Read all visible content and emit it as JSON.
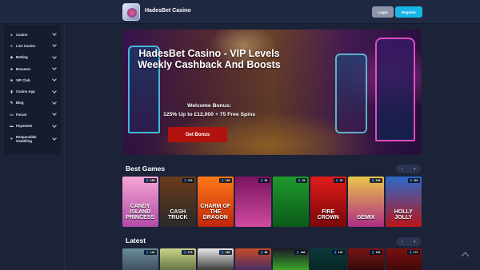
{
  "header": {
    "brand": "HadesBet Casino",
    "login_label": "Login",
    "register_label": "Register"
  },
  "sidebar": {
    "items": [
      {
        "label": "Casino",
        "icon": "♠"
      },
      {
        "label": "Live Casino",
        "icon": "●"
      },
      {
        "label": "Betting",
        "icon": "◆"
      },
      {
        "label": "Bonuses",
        "icon": "■"
      },
      {
        "label": "VIP Club",
        "icon": "★"
      },
      {
        "label": "Casino App",
        "icon": "▮"
      },
      {
        "label": "Blog",
        "icon": "✎"
      },
      {
        "label": "Forum",
        "icon": "▭"
      },
      {
        "label": "Payments",
        "icon": "▬"
      },
      {
        "label": "Responsible Gambling",
        "icon": "♥"
      }
    ]
  },
  "hero": {
    "title": "HadesBet Casino - VIP Levels Weekly Cashback And Boosts",
    "welcome": "Welcome Bonus:",
    "offer": "125% Up to £12,000 + 75 Free Spins",
    "cta": "Get Bonus"
  },
  "best_games": {
    "title": "Best Games",
    "prev": "‹",
    "next": "›",
    "items": [
      {
        "name": "CANDY ISLAND PRINCESS",
        "badge": "👤 155",
        "color_top": "#f6a6d4",
        "color_bot": "#b14aa8"
      },
      {
        "name": "CASH TRUCK",
        "badge": "👤 115",
        "color_top": "#6b3b1c",
        "color_bot": "#2a2a2a"
      },
      {
        "name": "CHARM OF THE DRAGON",
        "badge": "👤 126",
        "color_top": "#ff7a18",
        "color_bot": "#c0260b"
      },
      {
        "name": "",
        "badge": "👤 81",
        "color_top": "#7b1460",
        "color_bot": "#d04aa0"
      },
      {
        "name": "",
        "badge": "👤 25",
        "color_top": "#1e9a2c",
        "color_bot": "#0c5a18"
      },
      {
        "name": "FIRE CROWN",
        "badge": "👤 39",
        "color_top": "#e11b1b",
        "color_bot": "#7a0707"
      },
      {
        "name": "GEMIX",
        "badge": "👤 136",
        "color_top": "#e9c64a",
        "color_bot": "#b02b86"
      },
      {
        "name": "HOLLY JOLLY",
        "badge": "👤 116",
        "color_top": "#2b6ac9",
        "color_bot": "#b8161c"
      }
    ]
  },
  "latest": {
    "title": "Latest",
    "prev": "‹",
    "next": "›",
    "items": [
      {
        "badge": "👤 134",
        "color_top": "#6c8c9a",
        "color_bot": "#3a4a58"
      },
      {
        "badge": "👤 179",
        "color_top": "#c9d48a",
        "color_bot": "#5a6b3a"
      },
      {
        "badge": "👤 165",
        "color_top": "#eaeaea",
        "color_bot": "#2a2a2a"
      },
      {
        "badge": "👤 89",
        "color_top": "#c94a2a",
        "color_bot": "#3a2a6a"
      },
      {
        "badge": "👤 184",
        "color_top": "#1a1a24",
        "color_bot": "#3fb52a"
      },
      {
        "badge": "👤 142",
        "color_top": "#0a3a3a",
        "color_bot": "#062222"
      },
      {
        "badge": "👤 163",
        "color_top": "#7a1414",
        "color_bot": "#2a0a0a"
      },
      {
        "badge": "👤 174",
        "color_top": "#7a1010",
        "color_bot": "#3a0808"
      }
    ]
  }
}
